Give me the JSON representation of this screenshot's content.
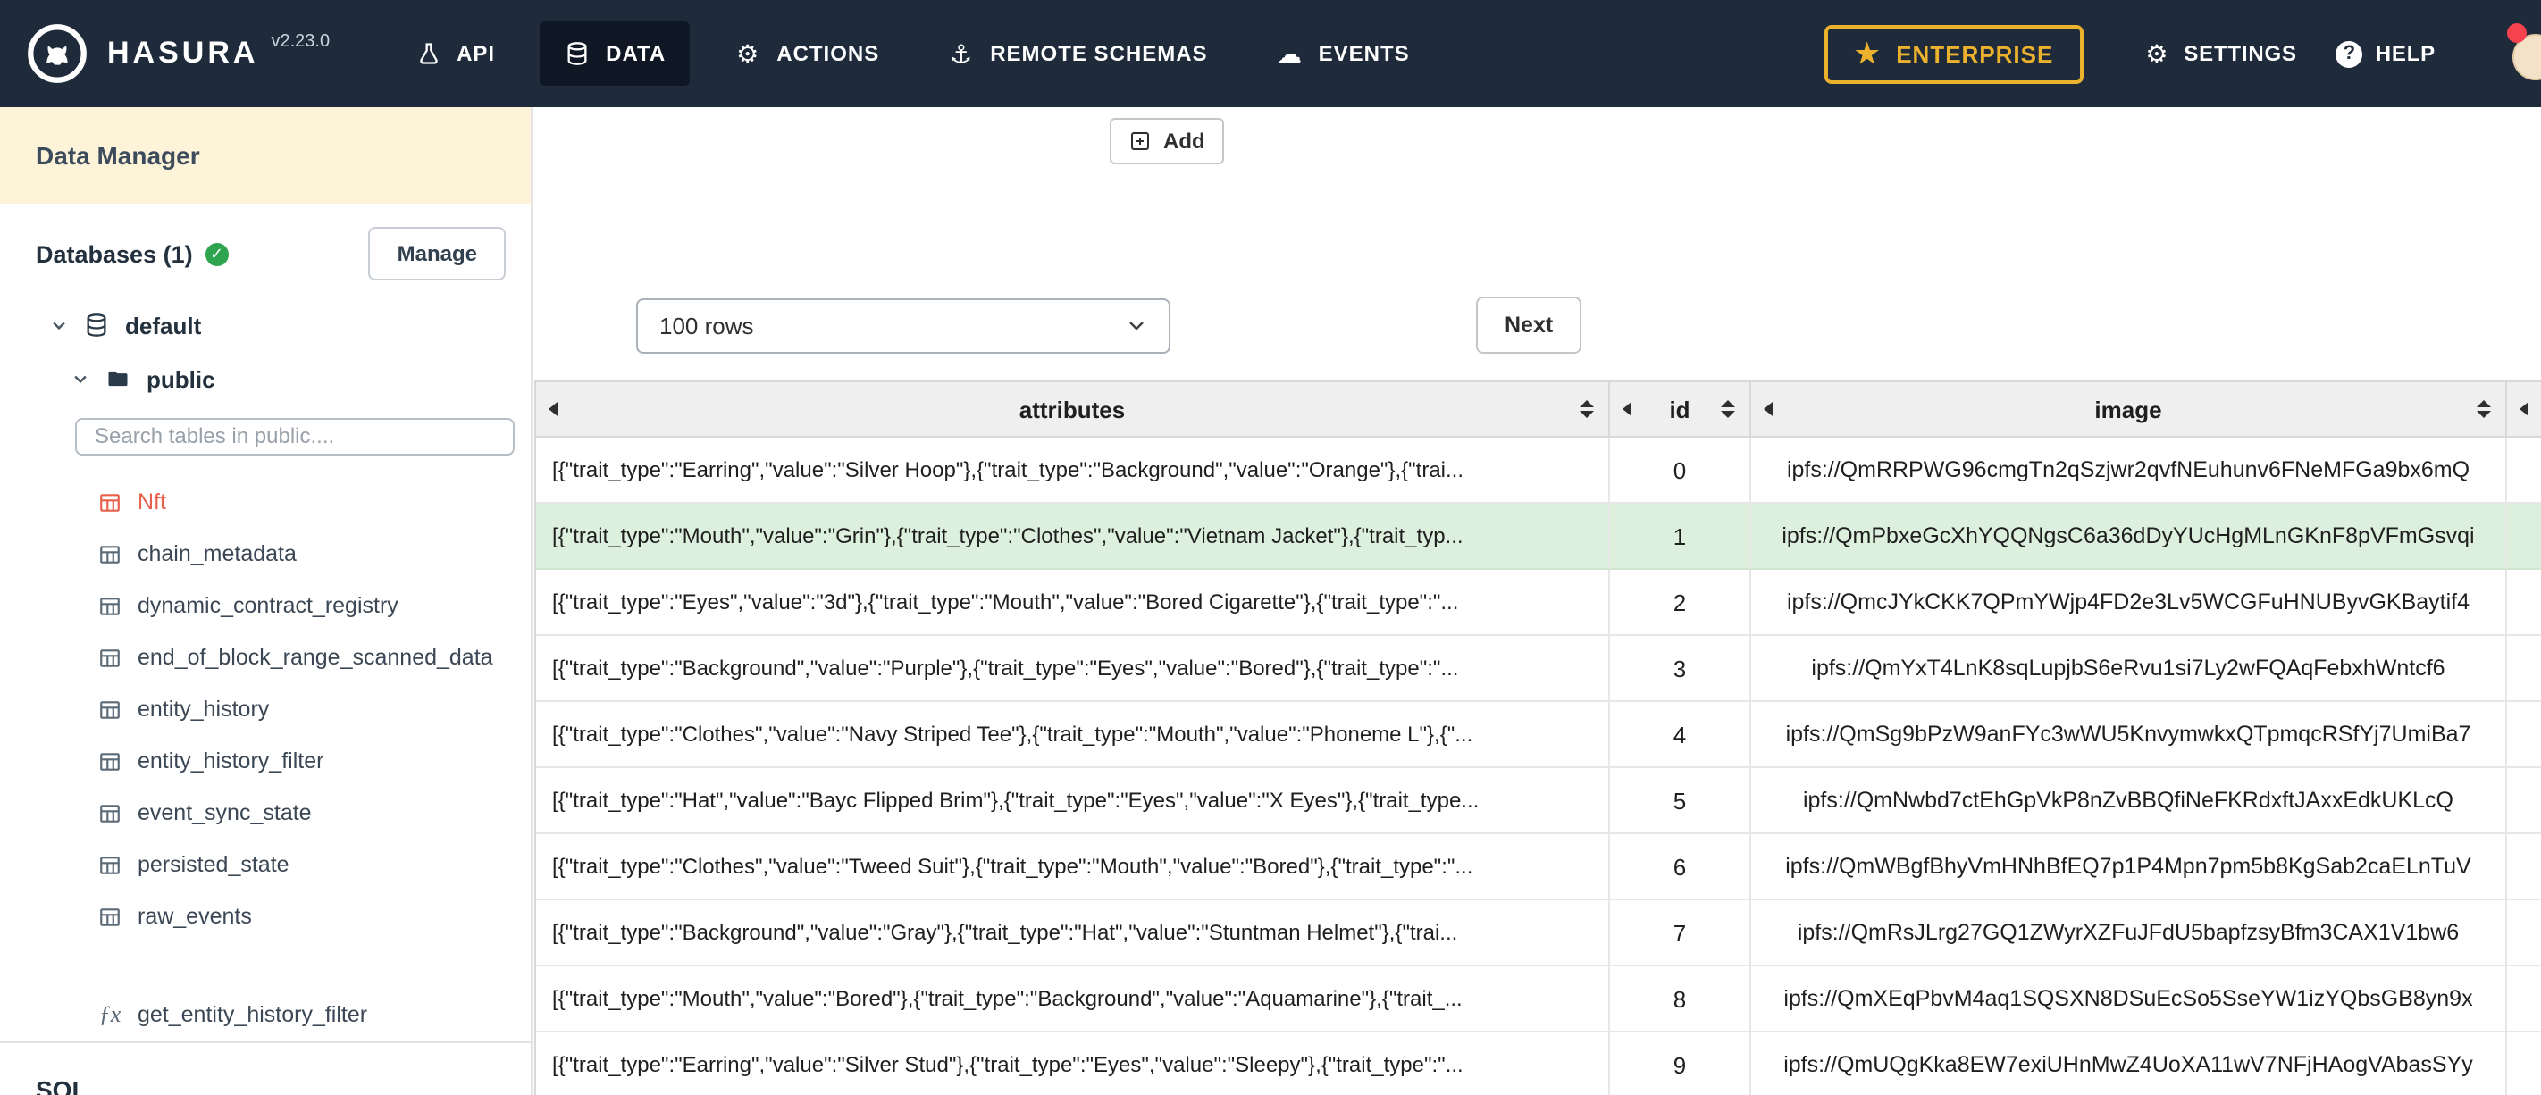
{
  "colors": {
    "navbar_bg": "#1f2b3b",
    "navbar_active_bg": "#0e1723",
    "enterprise_gold": "#ecb22e",
    "sidebar_header_bg": "#fcf3d9",
    "accent_orange": "#e8604c",
    "check_green": "#2ea44f",
    "selected_row_green": "#ddf0dd"
  },
  "navbar": {
    "brand": "HASURA",
    "version": "v2.23.0",
    "items": [
      {
        "label": "API"
      },
      {
        "label": "DATA"
      },
      {
        "label": "ACTIONS"
      },
      {
        "label": "REMOTE SCHEMAS"
      },
      {
        "label": "EVENTS"
      }
    ],
    "enterprise": "ENTERPRISE",
    "settings": "SETTINGS",
    "help": "HELP"
  },
  "sidebar": {
    "title": "Data Manager",
    "databases_label": "Databases (1)",
    "manage_button": "Manage",
    "database_name": "default",
    "schema_name": "public",
    "search_placeholder": "Search tables in public....",
    "tables": [
      "Nft",
      "chain_metadata",
      "dynamic_contract_registry",
      "end_of_block_range_scanned_data",
      "entity_history",
      "entity_history_filter",
      "event_sync_state",
      "persisted_state",
      "raw_events"
    ],
    "function_name": "get_entity_history_filter",
    "bottom_section": "SQL"
  },
  "toolbar": {
    "add": "Add",
    "rows_per_page": "100 rows",
    "next": "Next"
  },
  "table": {
    "columns": [
      "attributes",
      "id",
      "image"
    ],
    "selected_row_index": 1,
    "rows": [
      {
        "attributes": "[{\"trait_type\":\"Earring\",\"value\":\"Silver Hoop\"},{\"trait_type\":\"Background\",\"value\":\"Orange\"},{\"trai...",
        "id": 0,
        "image": "ipfs://QmRRPWG96cmgTn2qSzjwr2qvfNEuhunv6FNeMFGa9bx6mQ"
      },
      {
        "attributes": "[{\"trait_type\":\"Mouth\",\"value\":\"Grin\"},{\"trait_type\":\"Clothes\",\"value\":\"Vietnam Jacket\"},{\"trait_typ...",
        "id": 1,
        "image": "ipfs://QmPbxeGcXhYQQNgsC6a36dDyYUcHgMLnGKnF8pVFmGsvqi"
      },
      {
        "attributes": "[{\"trait_type\":\"Eyes\",\"value\":\"3d\"},{\"trait_type\":\"Mouth\",\"value\":\"Bored Cigarette\"},{\"trait_type\":\"...",
        "id": 2,
        "image": "ipfs://QmcJYkCKK7QPmYWjp4FD2e3Lv5WCGFuHNUByvGKBaytif4"
      },
      {
        "attributes": "[{\"trait_type\":\"Background\",\"value\":\"Purple\"},{\"trait_type\":\"Eyes\",\"value\":\"Bored\"},{\"trait_type\":\"...",
        "id": 3,
        "image": "ipfs://QmYxT4LnK8sqLupjbS6eRvu1si7Ly2wFQAqFebxhWntcf6"
      },
      {
        "attributes": "[{\"trait_type\":\"Clothes\",\"value\":\"Navy Striped Tee\"},{\"trait_type\":\"Mouth\",\"value\":\"Phoneme L\"},{\"...",
        "id": 4,
        "image": "ipfs://QmSg9bPzW9anFYc3wWU5KnvymwkxQTpmqcRSfYj7UmiBa7"
      },
      {
        "attributes": "[{\"trait_type\":\"Hat\",\"value\":\"Bayc Flipped Brim\"},{\"trait_type\":\"Eyes\",\"value\":\"X Eyes\"},{\"trait_type...",
        "id": 5,
        "image": "ipfs://QmNwbd7ctEhGpVkP8nZvBBQfiNeFKRdxftJAxxEdkUKLcQ"
      },
      {
        "attributes": "[{\"trait_type\":\"Clothes\",\"value\":\"Tweed Suit\"},{\"trait_type\":\"Mouth\",\"value\":\"Bored\"},{\"trait_type\":\"...",
        "id": 6,
        "image": "ipfs://QmWBgfBhyVmHNhBfEQ7p1P4Mpn7pm5b8KgSab2caELnTuV"
      },
      {
        "attributes": "[{\"trait_type\":\"Background\",\"value\":\"Gray\"},{\"trait_type\":\"Hat\",\"value\":\"Stuntman Helmet\"},{\"trai...",
        "id": 7,
        "image": "ipfs://QmRsJLrg27GQ1ZWyrXZFuJFdU5bapfzsyBfm3CAX1V1bw6"
      },
      {
        "attributes": "[{\"trait_type\":\"Mouth\",\"value\":\"Bored\"},{\"trait_type\":\"Background\",\"value\":\"Aquamarine\"},{\"trait_...",
        "id": 8,
        "image": "ipfs://QmXEqPbvM4aq1SQSXN8DSuEcSo5SseYW1izYQbsGB8yn9x"
      },
      {
        "attributes": "[{\"trait_type\":\"Earring\",\"value\":\"Silver Stud\"},{\"trait_type\":\"Eyes\",\"value\":\"Sleepy\"},{\"trait_type\":\"...",
        "id": 9,
        "image": "ipfs://QmUQgKka8EW7exiUHnMwZ4UoXA11wV7NFjHAogVAbasSYy"
      }
    ]
  }
}
